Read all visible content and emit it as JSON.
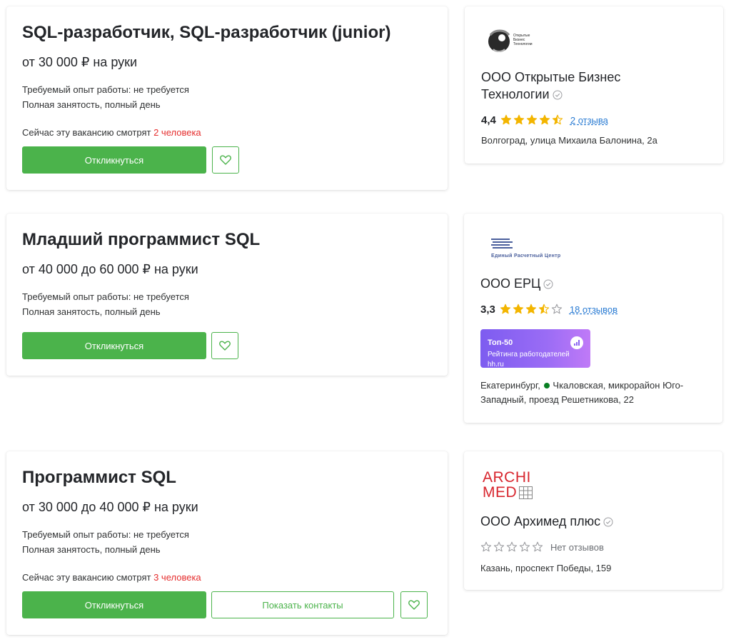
{
  "vacancies": [
    {
      "title": "SQL-разработчик, SQL-разработчик (junior)",
      "salary": "от 30 000 ₽ на руки",
      "experience": "Требуемый опыт работы: не требуется",
      "employment": "Полная занятость, полный день",
      "watching_prefix": "Сейчас эту вакансию смотрят ",
      "watching_count": "2 человека",
      "apply_label": "Откликнуться"
    },
    {
      "title": "Младший программист SQL",
      "salary": "от 40 000 до 60 000 ₽ на руки",
      "experience": "Требуемый опыт работы: не требуется",
      "employment": "Полная занятость, полный день",
      "apply_label": "Откликнуться"
    },
    {
      "title": "Программист SQL",
      "salary": "от 30 000 до 40 000 ₽ на руки",
      "experience": "Требуемый опыт работы: не требуется",
      "employment": "Полная занятость, полный день",
      "watching_prefix": "Сейчас эту вакансию смотрят ",
      "watching_count": "3 человека",
      "apply_label": "Откликнуться",
      "contacts_label": "Показать контакты"
    }
  ],
  "employers": [
    {
      "logo_text": [
        "Открытые",
        "Бизнес",
        "Технологии"
      ],
      "company": "ООО Открытые Бизнес Технологии",
      "rating": "4,4",
      "rating_value": 4.4,
      "reviews": "2 отзыва",
      "address": "Волгоград, улица Михаила Балонина, 2а"
    },
    {
      "logo_text": "Единый Расчетный Центр",
      "company": "ООО ЕРЦ",
      "rating": "3,3",
      "rating_value": 3.3,
      "reviews": "18 отзывов",
      "badge_title": "Топ-50",
      "badge_subtitle": "Рейтинга работодателей hh.ru",
      "address_city": "Екатеринбург, ",
      "address_rest": "Чкаловская, микрорайон Юго-Западный, проезд Решетникова, 22"
    },
    {
      "logo_text": [
        "ARCHI",
        "MED"
      ],
      "company": "ООО Архимед плюс",
      "rating_value": 0,
      "reviews": "Нет отзывов",
      "address": "Казань, проспект Победы, 159"
    }
  ],
  "colors": {
    "accent_green": "#4bb34b",
    "star_gold": "#f3b500",
    "star_empty": "#9c9da1",
    "link_blue": "#2b7cd3",
    "watch_red": "#e52e2e",
    "metro_green": "#087f23",
    "archimed_red": "#d8262e"
  },
  "icons": {
    "heart": "heart-icon",
    "verified": "verified-check-icon",
    "star": "star-icon",
    "metro": "metro-dot-icon"
  }
}
